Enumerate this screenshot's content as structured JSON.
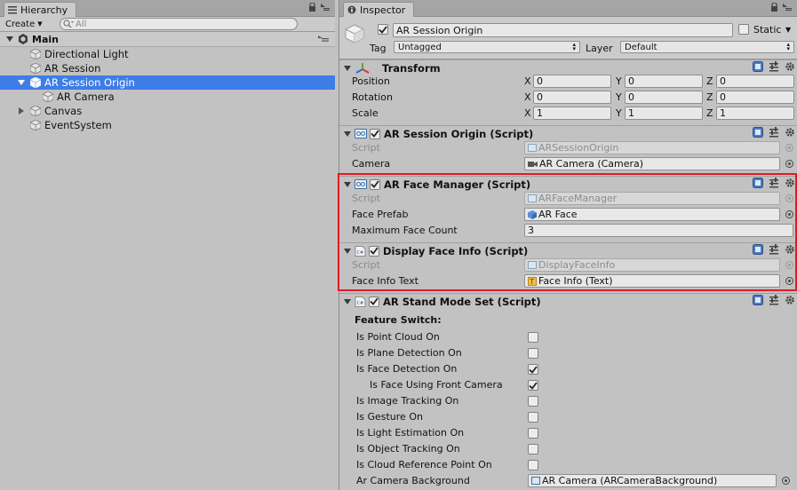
{
  "hierarchy": {
    "tab_label": "Hierarchy",
    "create_label": "Create",
    "search_placeholder": "All",
    "scene_name": "Main",
    "items": [
      {
        "label": "Directional Light"
      },
      {
        "label": "AR Session"
      },
      {
        "label": "AR Session Origin"
      },
      {
        "label": "AR Camera"
      },
      {
        "label": "Canvas"
      },
      {
        "label": "EventSystem"
      }
    ]
  },
  "inspector": {
    "tab_label": "Inspector",
    "object_name": "AR Session Origin",
    "static_label": "Static",
    "tag_label": "Tag",
    "tag_value": "Untagged",
    "layer_label": "Layer",
    "layer_value": "Default",
    "transform": {
      "title": "Transform",
      "position_label": "Position",
      "rotation_label": "Rotation",
      "scale_label": "Scale",
      "x": "X",
      "y": "Y",
      "z": "Z",
      "position": [
        "0",
        "0",
        "0"
      ],
      "rotation": [
        "0",
        "0",
        "0"
      ],
      "scale": [
        "1",
        "1",
        "1"
      ]
    },
    "session_origin": {
      "title": "AR Session Origin (Script)",
      "script_label": "Script",
      "script_value": "ARSessionOrigin",
      "camera_label": "Camera",
      "camera_value": "AR Camera (Camera)"
    },
    "face_manager": {
      "title": "AR Face Manager (Script)",
      "script_label": "Script",
      "script_value": "ARFaceManager",
      "prefab_label": "Face Prefab",
      "prefab_value": "AR Face",
      "max_label": "Maximum Face Count",
      "max_value": "3"
    },
    "display_face": {
      "title": "Display Face Info (Script)",
      "script_label": "Script",
      "script_value": "DisplayFaceInfo",
      "text_label": "Face Info Text",
      "text_value": "Face Info (Text)"
    },
    "stand_mode": {
      "title": "AR Stand Mode Set (Script)",
      "feature_label": "Feature Switch:",
      "toggles": [
        {
          "label": "Is Point Cloud On",
          "checked": false
        },
        {
          "label": "Is Plane Detection On",
          "checked": false
        },
        {
          "label": "Is Face Detection On",
          "checked": true
        },
        {
          "label": "Is Face Using Front Camera",
          "checked": true
        },
        {
          "label": "Is Image Tracking On",
          "checked": false
        },
        {
          "label": "Is Gesture On",
          "checked": false
        },
        {
          "label": "Is Light Estimation On",
          "checked": false
        },
        {
          "label": "Is Object Tracking On",
          "checked": false
        },
        {
          "label": "Is Cloud Reference Point On",
          "checked": false
        }
      ],
      "bg_label": "Ar Camera Background",
      "bg_value": "AR Camera (ARCameraBackground)"
    },
    "colors": {
      "selection": "#3e7de7",
      "highlight_box": "#e01b24"
    }
  }
}
